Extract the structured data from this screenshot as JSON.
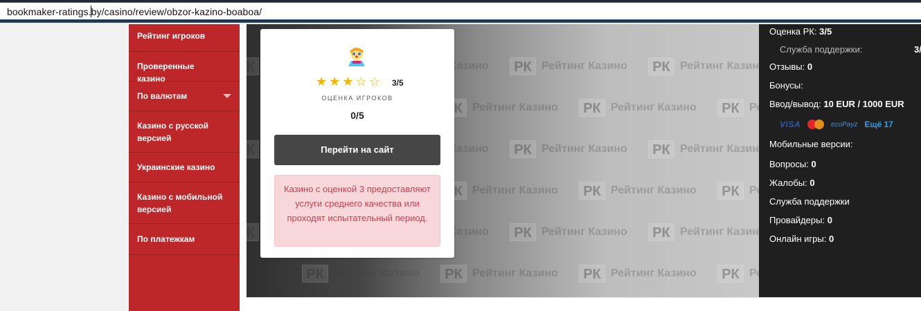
{
  "browser": {
    "url": "bookmaker-ratings.by/casino/review/obzor-kazino-boaboa/"
  },
  "sidebar": {
    "items": [
      {
        "label": "Рейтинг игроков"
      },
      {
        "label": "Проверенные казино"
      },
      {
        "label": "По валютам",
        "has_dropdown": true
      },
      {
        "label": "Казино с русской версией"
      },
      {
        "label": "Украинские казино"
      },
      {
        "label": "Казино с мобильной версией"
      },
      {
        "label": "По платежкам"
      }
    ]
  },
  "watermark": {
    "logo_text": "РК",
    "word1": "Рейтинг",
    "word2": "Казино"
  },
  "card": {
    "stars_filled": 3,
    "stars_total": 5,
    "score": "3/5",
    "rating_label": "ОЦЕНКА ИГРОКОВ",
    "rating_value": "0/5",
    "button_label": "Перейти на сайт",
    "alert_text": "Казино с оценкой 3 предоставляют услуги среднего качества или проходят испытательный период."
  },
  "info": {
    "rk_label": "Оценка РК:",
    "rk_value": "3/5",
    "support_label": "Служба поддержки:",
    "support_value": "3/",
    "reviews_label": "Отзывы:",
    "reviews_value": "0",
    "bonuses_label": "Бонусы:",
    "io_label": "Ввод/вывод:",
    "io_value": "10 EUR / 1000 EUR",
    "payments": [
      "VISA",
      "MasterCard",
      "ecoPayz"
    ],
    "payments_more": "Ещё 17",
    "mobile_label": "Мобильные версии:",
    "questions_label": "Вопросы:",
    "questions_value": "0",
    "complaints_label": "Жалобы:",
    "complaints_value": "0",
    "support2_label": "Служба поддержки",
    "providers_label": "Провайдеры:",
    "providers_value": "0",
    "games_label": "Онлайн игры:",
    "games_value": "0"
  },
  "colors": {
    "sidebar_bg": "#bd2729",
    "star": "#f4b400",
    "button_bg": "#464646",
    "alert_bg": "#f8d7da",
    "alert_text": "#c4414e",
    "info_bg": "#1f1f1f",
    "link": "#2f9be3"
  }
}
